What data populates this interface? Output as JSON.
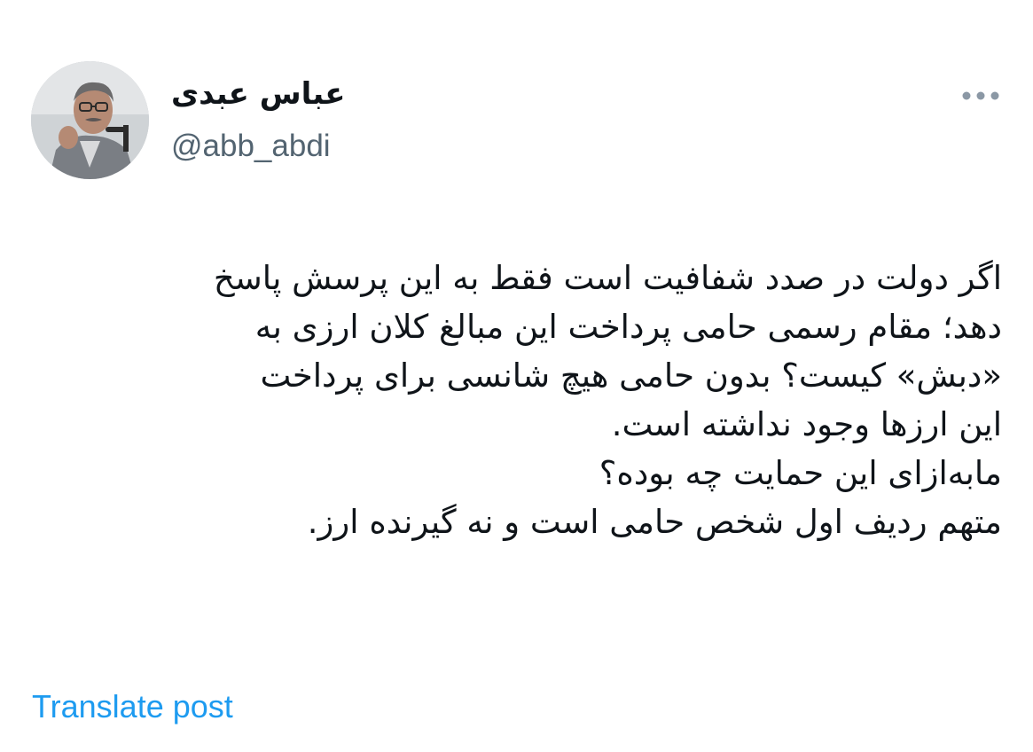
{
  "author": {
    "display_name": "عباس عبدی",
    "handle": "@abb_abdi"
  },
  "more_icon": "more-horizontal-icon",
  "tweet": {
    "lines": [
      "اگر دولت در صدد شفافیت است فقط به این پرسش پاسخ",
      "دهد؛ مقام رسمی حامی پرداخت این مبالغ کلان ارزی به",
      "«دبش» کیست؟ بدون حامی هیچ شانسی برای پرداخت",
      "این ارزها وجود نداشته است.",
      "مابه‌ازای این حمایت چه بوده؟",
      "متهم ردیف اول شخص حامی است و نه گیرنده ارز."
    ]
  },
  "translate_label": "Translate post",
  "colors": {
    "text_primary": "#0f1419",
    "text_secondary": "#536471",
    "link": "#1d9bf0",
    "background": "#ffffff"
  }
}
